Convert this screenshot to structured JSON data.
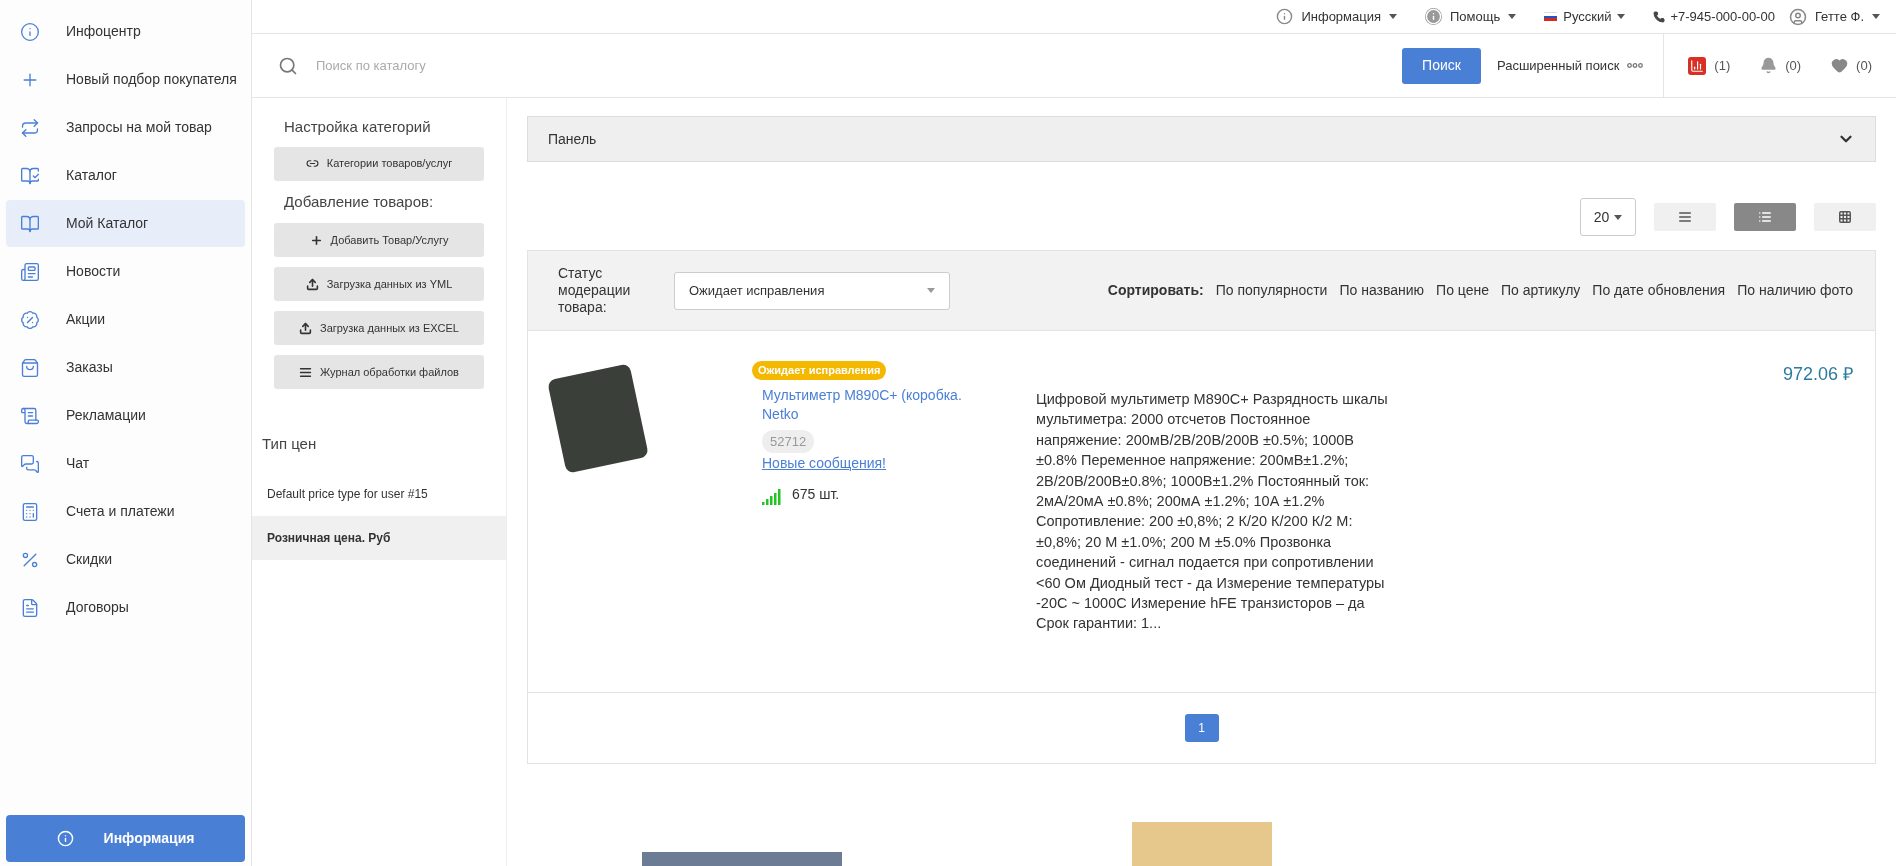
{
  "sidebar": {
    "items": [
      {
        "label": "Инфоцентр",
        "selected": false
      },
      {
        "label": "Новый подбор покупателя",
        "selected": false
      },
      {
        "label": "Запросы на мой товар",
        "selected": false
      },
      {
        "label": "Каталог",
        "selected": false
      },
      {
        "label": "Мой Каталог",
        "selected": true
      },
      {
        "label": "Новости",
        "selected": false
      },
      {
        "label": "Акции",
        "selected": false
      },
      {
        "label": "Заказы",
        "selected": false
      },
      {
        "label": "Рекламации",
        "selected": false
      },
      {
        "label": "Чат",
        "selected": false
      },
      {
        "label": "Счета и платежи",
        "selected": false
      },
      {
        "label": "Скидки",
        "selected": false
      },
      {
        "label": "Договоры",
        "selected": false
      }
    ],
    "info_button": "Информация"
  },
  "topbar": {
    "info": "Информация",
    "help": "Помощь",
    "language": "Русский",
    "phone": "+7-945-000-00-00",
    "user": "Гетте Ф."
  },
  "search": {
    "placeholder": "Поиск по каталогу",
    "button": "Поиск",
    "advanced": "Расширенный поиск",
    "compare_count": "(1)",
    "notifications_count": "(0)",
    "favorites_count": "(0)"
  },
  "left_panel": {
    "categories_title": "Настройка категорий",
    "categories_button": "Категории товаров/услуг",
    "adding_title": "Добавление товаров:",
    "actions": [
      {
        "kind": "add",
        "label": "Добавить Товар/Услугу"
      },
      {
        "kind": "upload",
        "label": "Загрузка данных из YML"
      },
      {
        "kind": "upload",
        "label": "Загрузка данных из EXCEL"
      },
      {
        "kind": "log",
        "label": "Журнал обработки файлов"
      }
    ],
    "price_type_title": "Тип цен",
    "price_types": [
      {
        "label": "Default price type for user #15",
        "selected": false
      },
      {
        "label": "Розничная цена. Руб",
        "selected": true
      }
    ]
  },
  "panel": {
    "title": "Панель",
    "expanded": false
  },
  "per_page": "20",
  "view_modes": [
    {
      "kind": "lines",
      "selected": false
    },
    {
      "kind": "list",
      "selected": true
    },
    {
      "kind": "grid",
      "selected": false
    }
  ],
  "filter": {
    "label": "Статус модерации товара:",
    "value": "Ожидает исправления"
  },
  "sort": {
    "label": "Сортировать:",
    "options": [
      "По популярности",
      "По названию",
      "По цене",
      "По артикулу",
      "По дате обновления",
      "По наличию фото"
    ]
  },
  "products": [
    {
      "badge": "Ожидает исправления",
      "title": "Мультиметр M890C+ (коробка. Netko",
      "sku": "52712",
      "messages_link": "Новые сообщения!",
      "stock": "675 шт.",
      "description": "Цифровой мультиметр M890C+ Разрядность шкалы мультиметра: 2000 отсчетов Постоянное напряжение: 200мВ/2В/20В/200В ±0.5%; 1000В ±0.8% Переменное напряжение: 200мВ±1.2%; 2В/20В/200В±0.8%; 1000В±1.2% Постоянный ток: 2мА/20мА ±0.8%; 200мА ±1.2%; 10А ±1.2% Сопротивление: 200 ±0,8%; 2 К/20 К/200 К/2 М: ±0,8%; 20 М ±1.0%; 200 М ±5.0% Прозвонка соединений - сигнал подается при сопротивлении <60 Ом Диодный тест - да Измерение температуры -20С ~ 1000С Измерение hFE транзисторов – да Срок гарантии: 1...",
      "price": "972.06 ₽"
    }
  ],
  "pagination": [
    {
      "label": "1",
      "selected": true
    }
  ]
}
